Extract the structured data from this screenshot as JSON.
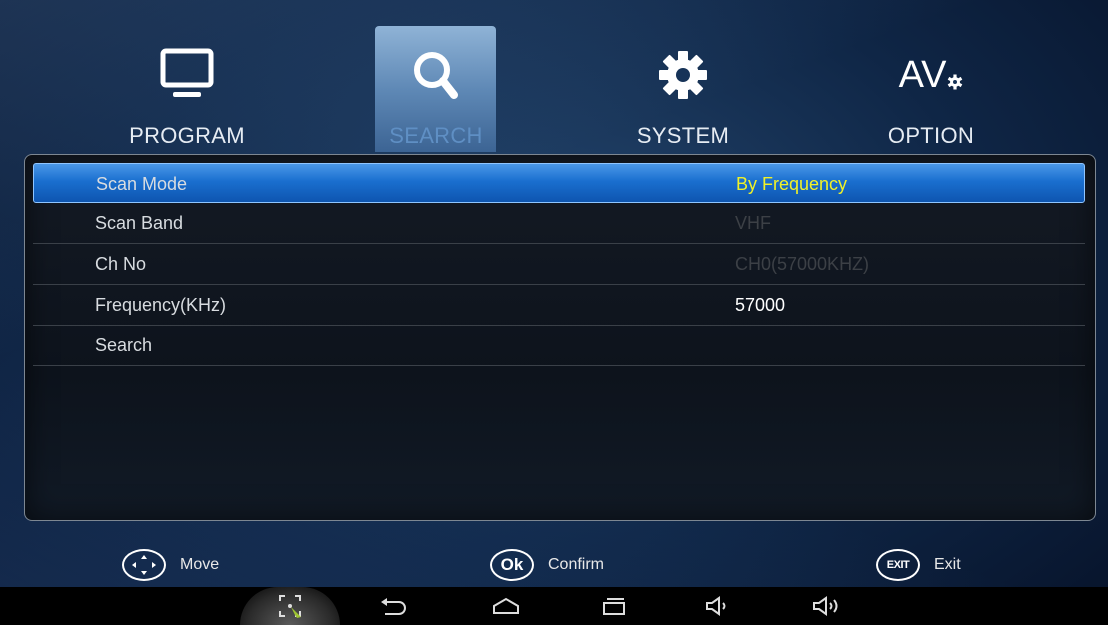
{
  "tabs": [
    {
      "label": "PROGRAM",
      "icon": "tv-icon",
      "active": false
    },
    {
      "label": "SEARCH",
      "icon": "search-icon",
      "active": true
    },
    {
      "label": "SYSTEM",
      "icon": "gear-icon",
      "active": false
    },
    {
      "label": "OPTION",
      "icon": "av-settings-icon",
      "icon_text": "AV",
      "active": false
    }
  ],
  "menu": {
    "rows": [
      {
        "label": "Scan Mode",
        "value": "By Frequency",
        "selected": true,
        "enabled": true
      },
      {
        "label": "Scan Band",
        "value": "VHF",
        "selected": false,
        "enabled": false
      },
      {
        "label": "Ch No",
        "value": "CH0(57000KHZ)",
        "selected": false,
        "enabled": false
      },
      {
        "label": "Frequency(KHz)",
        "value": "57000",
        "selected": false,
        "enabled": true
      },
      {
        "label": "Search",
        "value": "",
        "selected": false,
        "enabled": true
      }
    ]
  },
  "hints": {
    "move": {
      "icon": "dpad-icon",
      "label": "Move"
    },
    "confirm": {
      "icon": "ok-icon",
      "icon_text": "Ok",
      "label": "Confirm"
    },
    "exit": {
      "icon": "exit-icon",
      "icon_text": "EXIT",
      "label": "Exit"
    }
  },
  "navbar": [
    "screenshot-icon",
    "back-icon",
    "home-icon",
    "recents-icon",
    "volume-down-icon",
    "volume-up-icon"
  ],
  "colors": {
    "selected_row": "#1a6fcf",
    "selected_value": "#f1f227",
    "active_tab_label": "#5f8fc4"
  }
}
